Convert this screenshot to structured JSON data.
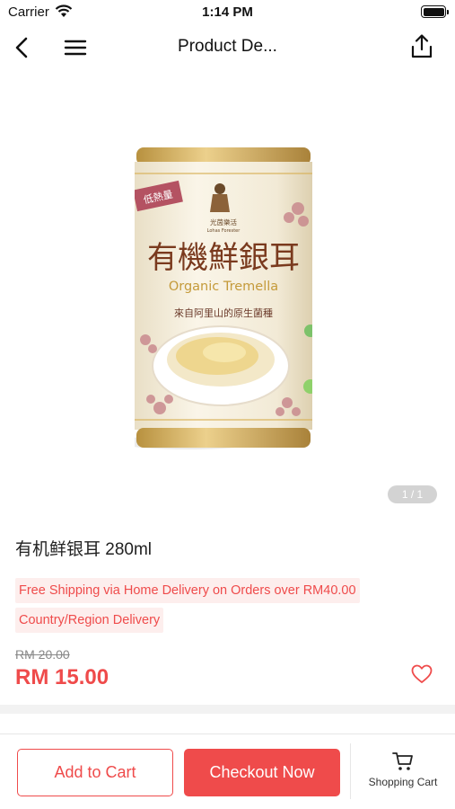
{
  "status_bar": {
    "carrier": "Carrier",
    "time": "1:14 PM"
  },
  "nav": {
    "title": "Product De...",
    "icons": [
      "back-icon",
      "menu-icon",
      "share-icon"
    ]
  },
  "gallery": {
    "page_indicator": "1 / 1",
    "can_label": {
      "badge": "低熱量",
      "brand_cn": "光茵樂活",
      "brand_en": "Lohas Forester",
      "title_cn": "有機鮮銀耳",
      "title_en": "Organic Tremella",
      "subtitle_cn": "來自阿里山的原生菌種"
    }
  },
  "product": {
    "name": "有机鲜银耳 280ml",
    "tags": [
      "Free Shipping via Home Delivery on Orders over RM40.00",
      "Country/Region Delivery"
    ],
    "original_price": "RM 20.00",
    "price": "RM 15.00"
  },
  "bottom_bar": {
    "add_to_cart": "Add to Cart",
    "checkout": "Checkout Now",
    "shopping_cart": "Shopping Cart"
  },
  "colors": {
    "accent": "#ef4b4b",
    "tag_bg": "#fdeeed",
    "can_gold": "#d9b25a",
    "can_cream": "#f4eddc"
  }
}
